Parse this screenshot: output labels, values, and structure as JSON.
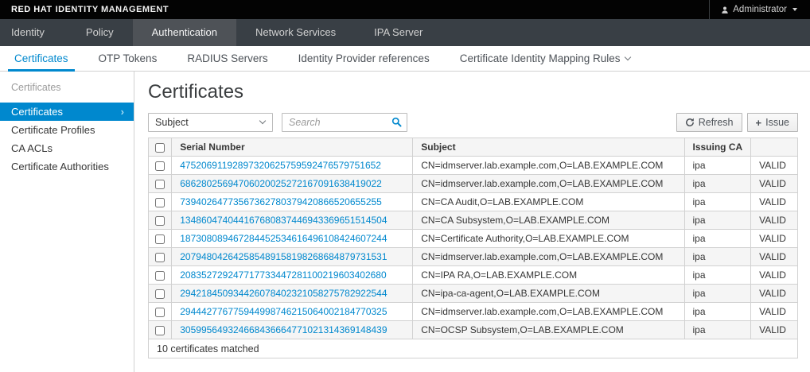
{
  "masthead": {
    "brand_strong": "RED HAT",
    "brand_light": "IDENTITY MANAGEMENT",
    "user": "Administrator"
  },
  "nav": {
    "active": "Authentication",
    "items": [
      {
        "label": "Identity"
      },
      {
        "label": "Policy"
      },
      {
        "label": "Authentication"
      },
      {
        "label": "Network Services"
      },
      {
        "label": "IPA Server"
      }
    ]
  },
  "tabs": {
    "active": "Certificates",
    "items": [
      {
        "label": "Certificates"
      },
      {
        "label": "OTP Tokens"
      },
      {
        "label": "RADIUS Servers"
      },
      {
        "label": "Identity Provider references"
      },
      {
        "label": "Certificate Identity Mapping Rules",
        "has_dropdown": true
      }
    ]
  },
  "sidebar": {
    "group_label": "Certificates",
    "items": [
      {
        "label": "Certificates",
        "selected": true
      },
      {
        "label": "Certificate Profiles",
        "selected": false
      },
      {
        "label": "CA ACLs",
        "selected": false
      },
      {
        "label": "Certificate Authorities",
        "selected": false
      }
    ]
  },
  "content": {
    "title": "Certificates",
    "filter": {
      "selected": "Subject"
    },
    "search": {
      "placeholder": "Search"
    },
    "buttons": {
      "refresh": "Refresh",
      "issue": "Issue"
    }
  },
  "table": {
    "headers": {
      "serial": "Serial Number",
      "subject": "Subject",
      "issuing_ca": "Issuing CA",
      "status": ""
    },
    "rows": [
      {
        "serial": "47520691192897320625759592476579751652",
        "subject": "CN=idmserver.lab.example.com,O=LAB.EXAMPLE.COM",
        "issuing_ca": "ipa",
        "status": "VALID"
      },
      {
        "serial": "68628025694706020025272167091638419022",
        "subject": "CN=idmserver.lab.example.com,O=LAB.EXAMPLE.COM",
        "issuing_ca": "ipa",
        "status": "VALID"
      },
      {
        "serial": "73940264773567362780379420866520655255",
        "subject": "CN=CA Audit,O=LAB.EXAMPLE.COM",
        "issuing_ca": "ipa",
        "status": "VALID"
      },
      {
        "serial": "134860474044167680837446943369651514504",
        "subject": "CN=CA Subsystem,O=LAB.EXAMPLE.COM",
        "issuing_ca": "ipa",
        "status": "VALID"
      },
      {
        "serial": "187308089467284452534616496108424607244",
        "subject": "CN=Certificate Authority,O=LAB.EXAMPLE.COM",
        "issuing_ca": "ipa",
        "status": "VALID"
      },
      {
        "serial": "207948042642585489158198268684879731531",
        "subject": "CN=idmserver.lab.example.com,O=LAB.EXAMPLE.COM",
        "issuing_ca": "ipa",
        "status": "VALID"
      },
      {
        "serial": "208352729247717733447281100219603402680",
        "subject": "CN=IPA RA,O=LAB.EXAMPLE.COM",
        "issuing_ca": "ipa",
        "status": "VALID"
      },
      {
        "serial": "294218450934426078402321058275782922544",
        "subject": "CN=ipa-ca-agent,O=LAB.EXAMPLE.COM",
        "issuing_ca": "ipa",
        "status": "VALID"
      },
      {
        "serial": "294442776775944998746215064002184770325",
        "subject": "CN=idmserver.lab.example.com,O=LAB.EXAMPLE.COM",
        "issuing_ca": "ipa",
        "status": "VALID"
      },
      {
        "serial": "305995649324668436664771021314369148439",
        "subject": "CN=OCSP Subsystem,O=LAB.EXAMPLE.COM",
        "issuing_ca": "ipa",
        "status": "VALID"
      }
    ],
    "summary": "10 certificates matched"
  },
  "colors": {
    "accent_blue": "#0088ce",
    "masthead_bg": "#030303",
    "navbar_bg": "#393f45",
    "navbar_active_bg": "#4e5257",
    "border_gray": "#d1d1d1",
    "stripe_gray": "#f5f5f5",
    "text_dark": "#363636"
  }
}
